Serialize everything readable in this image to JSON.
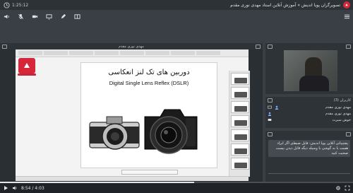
{
  "topbar": {
    "timer": "1:25:12",
    "title": "تصویرگران پویا اندیش » آموزش آنلاین استاد مهدی نوری مقدم"
  },
  "main_panel": {
    "presenter": "مهدی نوری مقدم",
    "page_label": "1"
  },
  "slide": {
    "title_fa": "دوربین های تک لنز انعکاسی",
    "title_en": "Digital Single Lens Reflex (DSLR)"
  },
  "webcam_panel": {},
  "users_panel": {
    "title": "کاربران (3)",
    "users": [
      {
        "name": "مهدی نوری مقدم"
      },
      {
        "name": "مهدی نوری مقدم"
      },
      {
        "name": "خوش سیرت"
      }
    ]
  },
  "chat": {
    "message": "پشتیبانی آنلاین پویا اندیش: فایل ضبط‌ی اگر ایراد هست یا به گوشی با وسیله دیگه قابل دیدن نیست صحبت کنید"
  },
  "playback": {
    "time": "8:54 / 4:03",
    "progress": 0.55
  },
  "colors": {
    "brand": "#d6263a",
    "bg": "#3a3f45",
    "accent": "#2f6fd6"
  }
}
